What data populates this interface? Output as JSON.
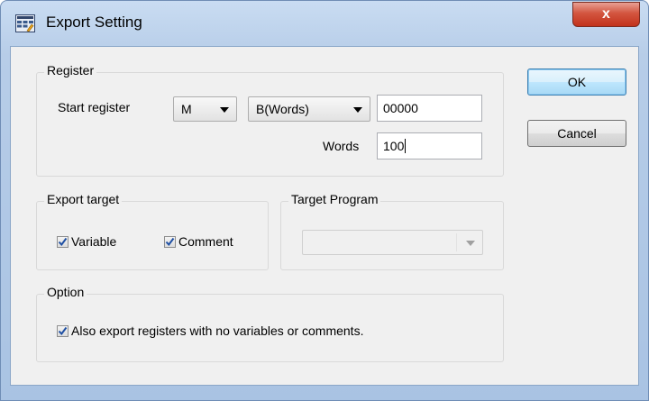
{
  "window": {
    "title": "Export Setting",
    "close_glyph": "x"
  },
  "register_group": {
    "title": "Register",
    "start_register_label": "Start register",
    "device_select": "M",
    "unit_select": "B(Words)",
    "start_address": "00000",
    "words_label": "Words",
    "words_value": "100"
  },
  "export_target_group": {
    "title": "Export target",
    "variable_label": "Variable",
    "variable_checked": true,
    "comment_label": "Comment",
    "comment_checked": true
  },
  "target_program_group": {
    "title": "Target Program",
    "select_value": ""
  },
  "option_group": {
    "title": "Option",
    "also_export_label": "Also export registers with no variables or comments.",
    "also_export_checked": true
  },
  "buttons": {
    "ok": "OK",
    "cancel": "Cancel"
  },
  "icons": {
    "app": "grid-app-icon",
    "close": "close-icon",
    "dropdown": "chevron-down-icon",
    "check": "checkmark-icon"
  },
  "colors": {
    "accent": "#3c7fb1",
    "close": "#c2321c",
    "check": "#1e4fa3"
  }
}
